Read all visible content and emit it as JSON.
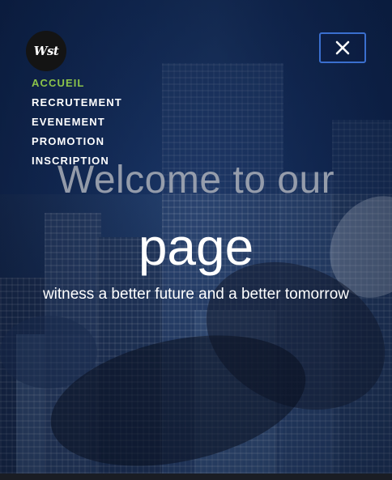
{
  "brand": {
    "logo_text": "Wst"
  },
  "nav": {
    "items": [
      {
        "label": "ACCUEIL",
        "active": true
      },
      {
        "label": "RECRUTEMENT",
        "active": false
      },
      {
        "label": "EVENEMENT",
        "active": false
      },
      {
        "label": "PROMOTION",
        "active": false
      },
      {
        "label": "INSCRIPTION",
        "active": false
      }
    ],
    "active_color": "#8bc34a"
  },
  "close_button": {
    "icon": "close-icon",
    "border_color": "#3a6fcf"
  },
  "hero": {
    "title_line1": "Welcome to our",
    "title_line2": "page",
    "subtitle": "witness a better future and a better tomorrow"
  }
}
